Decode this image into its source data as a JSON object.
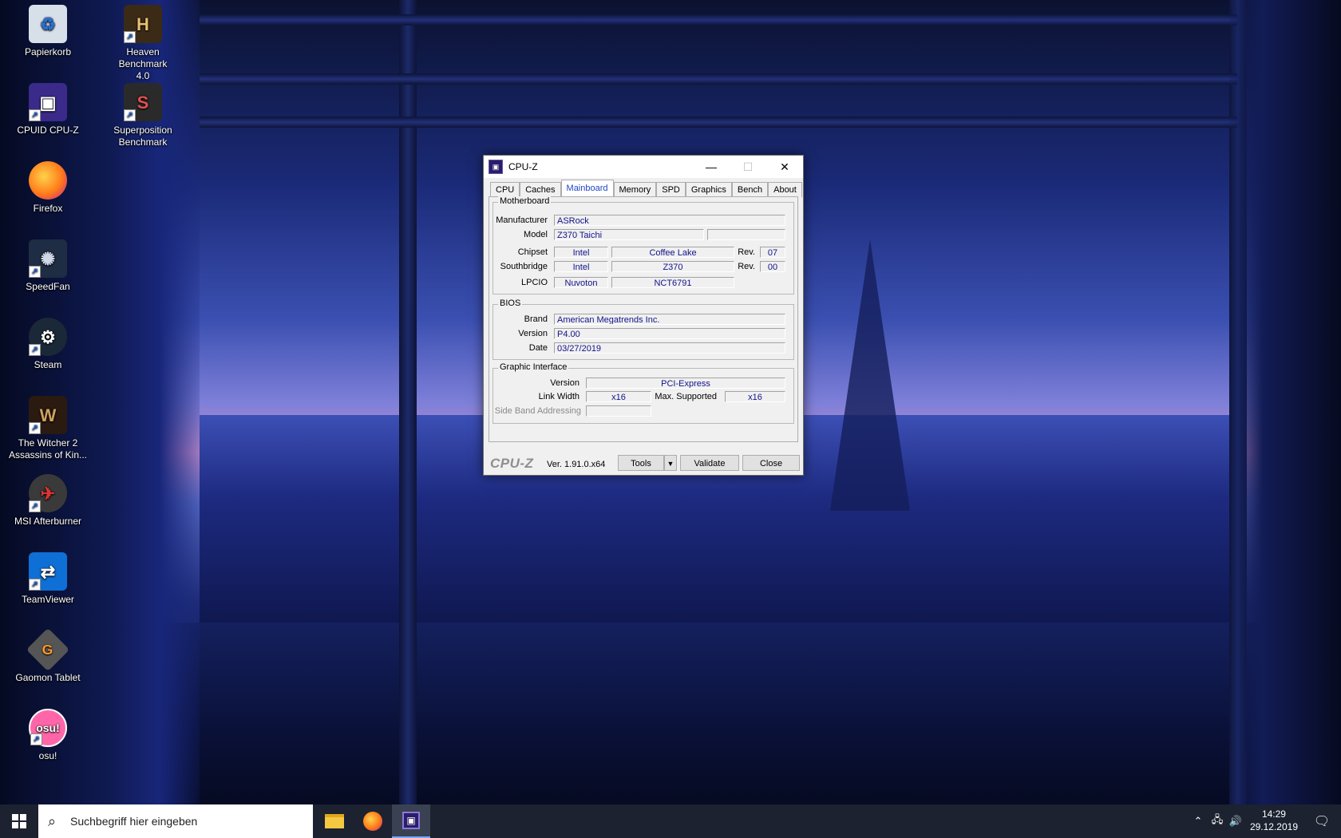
{
  "desktop": {
    "icons": [
      {
        "label": "Papierkorb",
        "glyph": "🗑",
        "bg": "#d7dfe8"
      },
      {
        "label": "Heaven Benchmark\n4.0",
        "glyph": "H",
        "bg": "#3b2a16"
      },
      {
        "label": "CPUID CPU-Z",
        "glyph": "▣",
        "bg": "#3a2a8a"
      },
      {
        "label": "Superposition\nBenchmark",
        "glyph": "S",
        "bg": "#2a2a2a"
      },
      {
        "label": "Firefox",
        "glyph": "◉",
        "bg": "#ff7a1a"
      },
      {
        "label": "SpeedFan",
        "glyph": "✺",
        "bg": "#1e2c44"
      },
      {
        "label": "Steam",
        "glyph": "⚙",
        "bg": "#1b2838"
      },
      {
        "label": "The Witcher 2\nAssassins of Kin...",
        "glyph": "W",
        "bg": "#2a1a10"
      },
      {
        "label": "MSI Afterburner",
        "glyph": "✈",
        "bg": "#3a3a3a"
      },
      {
        "label": "TeamViewer",
        "glyph": "⇄",
        "bg": "#0e6fd6"
      },
      {
        "label": "Gaomon Tablet",
        "glyph": "G",
        "bg": "#555"
      },
      {
        "label": "osu!",
        "glyph": "osu!",
        "bg": "#ff66aa"
      }
    ]
  },
  "cpuz": {
    "title": "CPU-Z",
    "tabs": [
      "CPU",
      "Caches",
      "Mainboard",
      "Memory",
      "SPD",
      "Graphics",
      "Bench",
      "About"
    ],
    "active_tab": "Mainboard",
    "motherboard": {
      "legend": "Motherboard",
      "manufacturer_label": "Manufacturer",
      "manufacturer": "ASRock",
      "model_label": "Model",
      "model": "Z370 Taichi",
      "model_extra": "",
      "chipset_label": "Chipset",
      "chipset_vendor": "Intel",
      "chipset_name": "Coffee Lake",
      "chipset_rev_label": "Rev.",
      "chipset_rev": "07",
      "southbridge_label": "Southbridge",
      "southbridge_vendor": "Intel",
      "southbridge_name": "Z370",
      "southbridge_rev_label": "Rev.",
      "southbridge_rev": "00",
      "lpcio_label": "LPCIO",
      "lpcio_vendor": "Nuvoton",
      "lpcio_name": "NCT6791"
    },
    "bios": {
      "legend": "BIOS",
      "brand_label": "Brand",
      "brand": "American Megatrends Inc.",
      "version_label": "Version",
      "version": "P4.00",
      "date_label": "Date",
      "date": "03/27/2019"
    },
    "graphic_interface": {
      "legend": "Graphic Interface",
      "version_label": "Version",
      "version": "PCI-Express",
      "link_width_label": "Link Width",
      "link_width": "x16",
      "max_supported_label": "Max. Supported",
      "max_supported": "x16",
      "sba_label": "Side Band Addressing",
      "sba": ""
    },
    "footer": {
      "logo": "CPU-Z",
      "version": "Ver. 1.91.0.x64",
      "tools": "Tools",
      "validate": "Validate",
      "close": "Close"
    }
  },
  "taskbar": {
    "search_placeholder": "Suchbegriff hier eingeben",
    "time": "14:29",
    "date": "29.12.2019"
  }
}
